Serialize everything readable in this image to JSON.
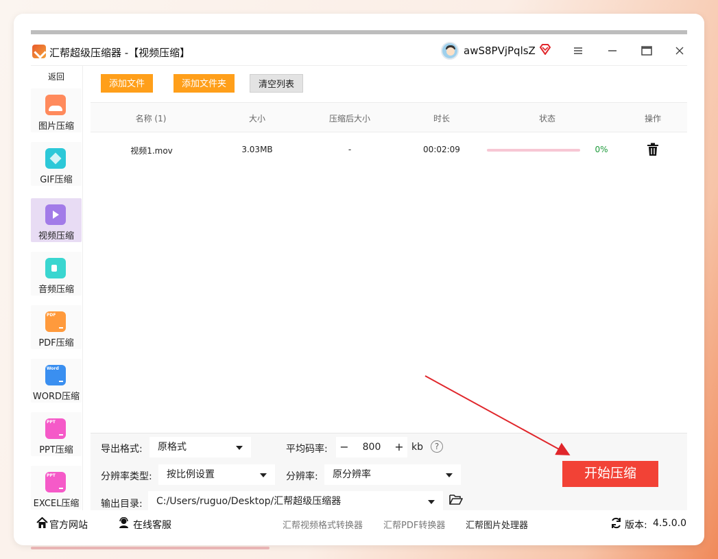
{
  "window": {
    "title": "汇帮超级压缩器 -【视频压缩】",
    "user_name": "awS8PVjPqlsZ"
  },
  "sidebar": {
    "back_label": "返回",
    "items": [
      {
        "label": "图片压缩",
        "icon": "image-icon",
        "color": "#ff8a5c"
      },
      {
        "label": "GIF压缩",
        "icon": "gif-icon",
        "color": "#2cc8d8"
      },
      {
        "label": "视频压缩",
        "icon": "video-play-icon",
        "color": "#a27be8",
        "active": true
      },
      {
        "label": "音频压缩",
        "icon": "audio-icon",
        "color": "#3ad6d0"
      },
      {
        "label": "PDF压缩",
        "icon": "pdf-file-icon",
        "color": "#ff9a3c",
        "badge": "PDF"
      },
      {
        "label": "WORD压缩",
        "icon": "word-file-icon",
        "color": "#3a8ff0",
        "badge": "Word"
      },
      {
        "label": "PPT压缩",
        "icon": "ppt-file-icon",
        "color": "#f55ac8",
        "badge": "PPT"
      },
      {
        "label": "EXCEL压缩",
        "icon": "excel-file-icon",
        "color": "#f55ac8",
        "badge": "PPT"
      }
    ]
  },
  "toolbar": {
    "add_file": "添加文件",
    "add_folder": "添加文件夹",
    "clear_list": "清空列表"
  },
  "table": {
    "headers": [
      "名称 (1)",
      "大小",
      "压缩后大小",
      "时长",
      "状态",
      "操作"
    ],
    "rows": [
      {
        "name": "视频1.mov",
        "size": "3.03MB",
        "compressed_size": "-",
        "duration": "00:02:09",
        "progress": 0,
        "progress_label": "0%"
      }
    ]
  },
  "settings": {
    "export_format_label": "导出格式:",
    "export_format_value": "原格式",
    "avg_bitrate_label": "平均码率:",
    "bitrate_value": "800",
    "bitrate_unit": "kb",
    "resolution_type_label": "分辨率类型:",
    "resolution_type_value": "按比例设置",
    "resolution_label": "分辨率:",
    "resolution_value": "原分辨率",
    "output_dir_label": "输出目录:",
    "output_dir_value": "C:/Users/ruguo/Desktop/汇帮超级压缩器",
    "start_button": "开始压缩"
  },
  "footer": {
    "website": "官方网站",
    "support": "在线客服",
    "link_video_converter": "汇帮视频格式转换器",
    "link_pdf_converter": "汇帮PDF转换器",
    "link_image_processor": "汇帮图片处理器",
    "version_label": "版本:",
    "version_value": "4.5.0.0"
  },
  "colors": {
    "accent_orange": "#ff9f1a",
    "start_red": "#f24236",
    "progress_green": "#1d9a3a"
  }
}
